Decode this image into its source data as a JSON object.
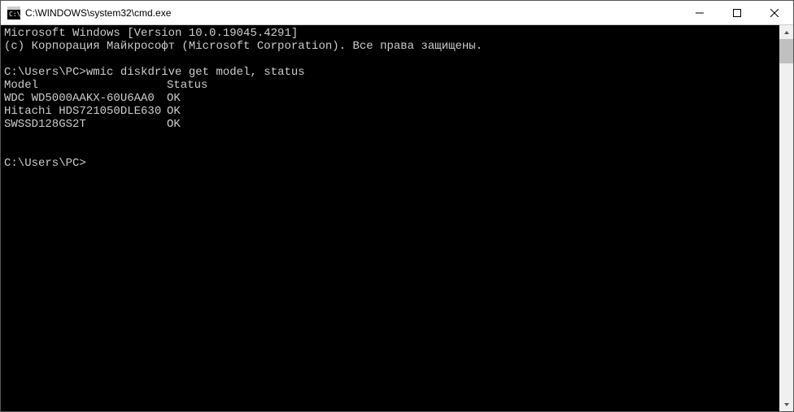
{
  "titlebar": {
    "title": "C:\\WINDOWS\\system32\\cmd.exe"
  },
  "console": {
    "header_line1": "Microsoft Windows [Version 10.0.19045.4291]",
    "header_line2": "(c) Корпорация Майкрософт (Microsoft Corporation). Все права защищены.",
    "prompt1_path": "C:\\Users\\PC>",
    "prompt1_cmd": "wmic diskdrive get model, status",
    "table_header_model": "Model",
    "table_header_status": "Status",
    "rows": [
      {
        "model": "WDC WD5000AAKX-60U6AA0",
        "status": "OK"
      },
      {
        "model": "Hitachi HDS721050DLE630",
        "status": "OK"
      },
      {
        "model": "SWSSD128GS2T",
        "status": "OK"
      }
    ],
    "prompt2_path": "C:\\Users\\PC>"
  }
}
